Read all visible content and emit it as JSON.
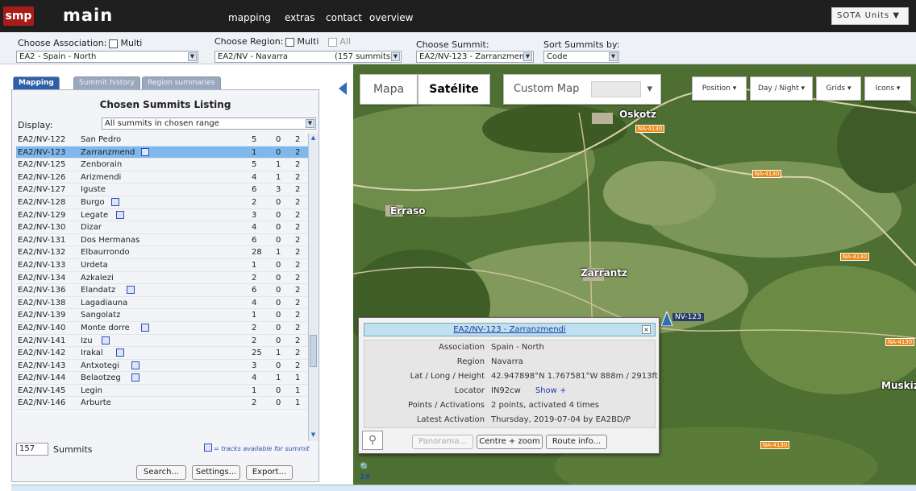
{
  "header": {
    "logo": "smp",
    "title": "main",
    "nav": [
      "mapping",
      "extras",
      "contact",
      "overview"
    ],
    "units": "SOTA Units ▼"
  },
  "selectors": {
    "association": {
      "label": "Choose Association:",
      "multi": "Multi",
      "value": "EA2 - Spain - North"
    },
    "region": {
      "label": "Choose Region:",
      "multi": "Multi",
      "all": "All",
      "value": "EA2/NV - Navarra",
      "summits": "(157 summits)"
    },
    "summit": {
      "label": "Choose Summit:",
      "value": "EA2/NV-123 - Zarranzmend"
    },
    "sort": {
      "label": "Sort Summits by:",
      "value": "Code"
    }
  },
  "tabs": [
    "Mapping",
    "Summit history",
    "Region summaries"
  ],
  "listing": {
    "title": "Chosen Summits Listing",
    "display_label": "Display:",
    "display_value": "All summits in chosen range",
    "rows": [
      {
        "code": "EA2/NV-122",
        "name": "San Pedro",
        "points": "5",
        "act": "0",
        "x": "2",
        "track": false
      },
      {
        "code": "EA2/NV-123",
        "name": "Zarranzmend",
        "points": "1",
        "act": "0",
        "x": "2",
        "track": true
      },
      {
        "code": "EA2/NV-125",
        "name": "Zenborain",
        "points": "5",
        "act": "1",
        "x": "2",
        "track": false
      },
      {
        "code": "EA2/NV-126",
        "name": "Arizmendi",
        "points": "4",
        "act": "1",
        "x": "2",
        "track": false
      },
      {
        "code": "EA2/NV-127",
        "name": "Iguste",
        "points": "6",
        "act": "3",
        "x": "2",
        "track": false
      },
      {
        "code": "EA2/NV-128",
        "name": "Burgo",
        "points": "2",
        "act": "0",
        "x": "2",
        "track": true
      },
      {
        "code": "EA2/NV-129",
        "name": "Legate",
        "points": "3",
        "act": "0",
        "x": "2",
        "track": true
      },
      {
        "code": "EA2/NV-130",
        "name": "Dizar",
        "points": "4",
        "act": "0",
        "x": "2",
        "track": false
      },
      {
        "code": "EA2/NV-131",
        "name": "Dos Hermanas",
        "points": "6",
        "act": "0",
        "x": "2",
        "track": false
      },
      {
        "code": "EA2/NV-132",
        "name": "Elbaurrondo",
        "points": "28",
        "act": "1",
        "x": "2",
        "track": false
      },
      {
        "code": "EA2/NV-133",
        "name": "Urdeta",
        "points": "1",
        "act": "0",
        "x": "2",
        "track": false
      },
      {
        "code": "EA2/NV-134",
        "name": "Azkalezi",
        "points": "2",
        "act": "0",
        "x": "2",
        "track": false
      },
      {
        "code": "EA2/NV-136",
        "name": "Elandatz",
        "points": "6",
        "act": "0",
        "x": "2",
        "track": true
      },
      {
        "code": "EA2/NV-138",
        "name": "Lagadiauna",
        "points": "4",
        "act": "0",
        "x": "2",
        "track": false
      },
      {
        "code": "EA2/NV-139",
        "name": "Sangolatz",
        "points": "1",
        "act": "0",
        "x": "2",
        "track": false
      },
      {
        "code": "EA2/NV-140",
        "name": "Monte dorre",
        "points": "2",
        "act": "0",
        "x": "2",
        "track": true
      },
      {
        "code": "EA2/NV-141",
        "name": "Izu",
        "points": "2",
        "act": "0",
        "x": "2",
        "track": true
      },
      {
        "code": "EA2/NV-142",
        "name": "Irakal",
        "points": "25",
        "act": "1",
        "x": "2",
        "track": true
      },
      {
        "code": "EA2/NV-143",
        "name": "Antxotegi",
        "points": "3",
        "act": "0",
        "x": "2",
        "track": true
      },
      {
        "code": "EA2/NV-144",
        "name": "Belaotzeg",
        "points": "4",
        "act": "1",
        "x": "1",
        "track": true
      },
      {
        "code": "EA2/NV-145",
        "name": "Legin",
        "points": "1",
        "act": "0",
        "x": "1",
        "track": false
      },
      {
        "code": "EA2/NV-146",
        "name": "Arburte",
        "points": "2",
        "act": "0",
        "x": "1",
        "track": false
      }
    ],
    "count": "157",
    "count_label": "Summits",
    "track_note": "= tracks available for summit",
    "buttons": [
      "Search...",
      "Settings...",
      "Export..."
    ]
  },
  "map": {
    "types": [
      "Mapa",
      "Satélite",
      "Custom Map"
    ],
    "controls": [
      "Position",
      "Day / Night",
      "Grids",
      "Icons"
    ],
    "places": [
      "Oskotz",
      "Erraso",
      "Zarrantz",
      "Muskiz"
    ],
    "roads": [
      "NA-4130",
      "NA-4130",
      "NA-4130",
      "NA-4130",
      "NA-4130"
    ],
    "marker": "NV-123",
    "zoom": "14"
  },
  "popup": {
    "title": "EA2/NV-123 - Zarranzmendi",
    "rows": [
      {
        "k": "Association",
        "v": "Spain - North"
      },
      {
        "k": "Region",
        "v": "Navarra"
      },
      {
        "k": "Lat / Long / Height",
        "v": "42.947898°N   1.767581°W   888m / 2913ft"
      },
      {
        "k": "Locator",
        "v": "IN92cw",
        "link": "Show +"
      },
      {
        "k": "Points / Activations",
        "v": "2 points, activated 4 times"
      },
      {
        "k": "Latest Activation",
        "v": "Thursday, 2019-07-04 by EA2BD/P"
      }
    ],
    "buttons": [
      "Panorama...",
      "Centre + zoom",
      "Route info..."
    ]
  }
}
